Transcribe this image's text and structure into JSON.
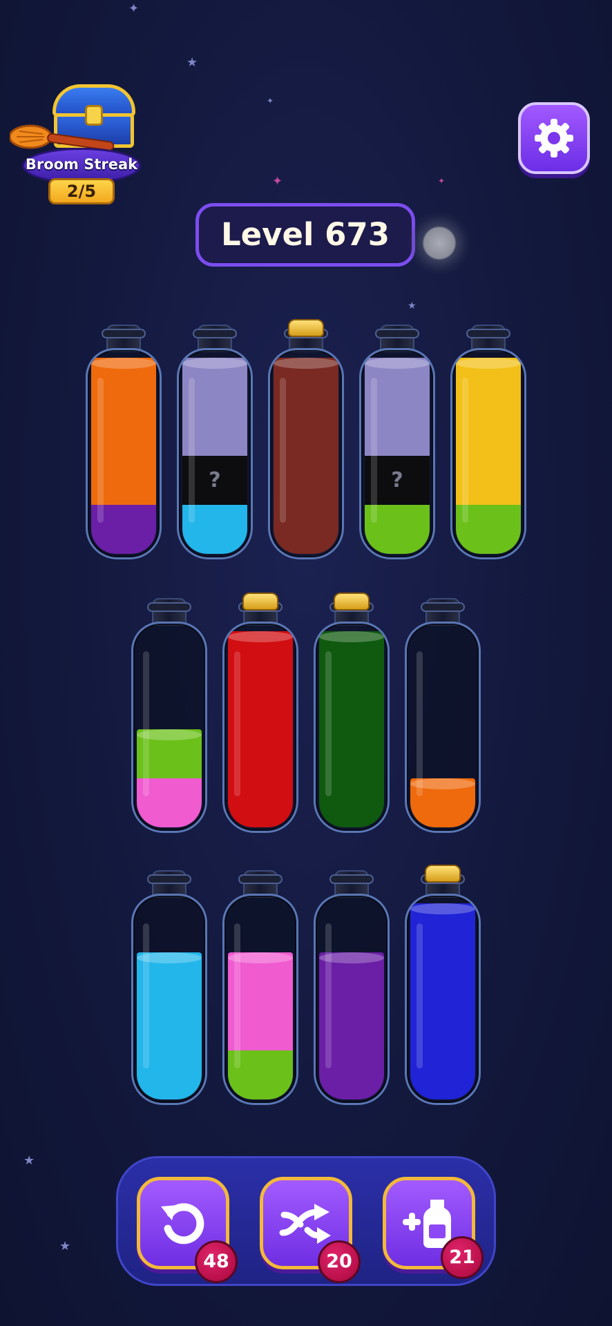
{
  "header": {
    "streak_title": "Broom Streak",
    "streak_progress": "2/5",
    "level_label": "Level 673"
  },
  "colors": {
    "orange": "#ef6a0c",
    "purple": "#6a1fa6",
    "lavender": "#8d86c4",
    "mystery": "#0d0d10",
    "cyan": "#23b6ea",
    "brown": "#7a2a22",
    "lime": "#6bc01a",
    "yellow": "#f2c018",
    "pink": "#f05bd0",
    "red": "#d10e12",
    "green": "#0f5a0f",
    "blue": "#2024d6"
  },
  "bottles": [
    {
      "row": 1,
      "index": 1,
      "capped": false,
      "layers_bottom_to_top": [
        {
          "color": "purple",
          "units": 1
        },
        {
          "color": "orange",
          "units": 3
        }
      ]
    },
    {
      "row": 1,
      "index": 2,
      "capped": false,
      "layers_bottom_to_top": [
        {
          "color": "cyan",
          "units": 1
        },
        {
          "color": "mystery",
          "units": 1,
          "label": "?"
        },
        {
          "color": "lavender",
          "units": 2
        }
      ]
    },
    {
      "row": 1,
      "index": 3,
      "capped": true,
      "layers_bottom_to_top": [
        {
          "color": "brown",
          "units": 4
        }
      ]
    },
    {
      "row": 1,
      "index": 4,
      "capped": false,
      "layers_bottom_to_top": [
        {
          "color": "lime",
          "units": 1
        },
        {
          "color": "mystery",
          "units": 1,
          "label": "?"
        },
        {
          "color": "lavender",
          "units": 2
        }
      ]
    },
    {
      "row": 1,
      "index": 5,
      "capped": false,
      "layers_bottom_to_top": [
        {
          "color": "lime",
          "units": 1
        },
        {
          "color": "yellow",
          "units": 3
        }
      ]
    },
    {
      "row": 2,
      "index": 1,
      "capped": false,
      "layers_bottom_to_top": [
        {
          "color": "pink",
          "units": 1
        },
        {
          "color": "lime",
          "units": 1
        }
      ]
    },
    {
      "row": 2,
      "index": 2,
      "capped": true,
      "layers_bottom_to_top": [
        {
          "color": "red",
          "units": 4
        }
      ]
    },
    {
      "row": 2,
      "index": 3,
      "capped": true,
      "layers_bottom_to_top": [
        {
          "color": "green",
          "units": 4
        }
      ]
    },
    {
      "row": 2,
      "index": 4,
      "capped": false,
      "layers_bottom_to_top": [
        {
          "color": "orange",
          "units": 1
        }
      ]
    },
    {
      "row": 3,
      "index": 1,
      "capped": false,
      "layers_bottom_to_top": [
        {
          "color": "cyan",
          "units": 3
        }
      ]
    },
    {
      "row": 3,
      "index": 2,
      "capped": false,
      "layers_bottom_to_top": [
        {
          "color": "lime",
          "units": 1
        },
        {
          "color": "pink",
          "units": 2
        }
      ]
    },
    {
      "row": 3,
      "index": 3,
      "capped": false,
      "layers_bottom_to_top": [
        {
          "color": "purple",
          "units": 3
        }
      ]
    },
    {
      "row": 3,
      "index": 4,
      "capped": true,
      "layers_bottom_to_top": [
        {
          "color": "blue",
          "units": 4
        }
      ]
    }
  ],
  "capacity_units": 4,
  "boosters": {
    "undo": {
      "icon": "undo-icon",
      "count": "48"
    },
    "shuffle": {
      "icon": "shuffle-icon",
      "count": "20"
    },
    "add_bottle": {
      "icon": "add-bottle-icon",
      "count": "21"
    }
  }
}
